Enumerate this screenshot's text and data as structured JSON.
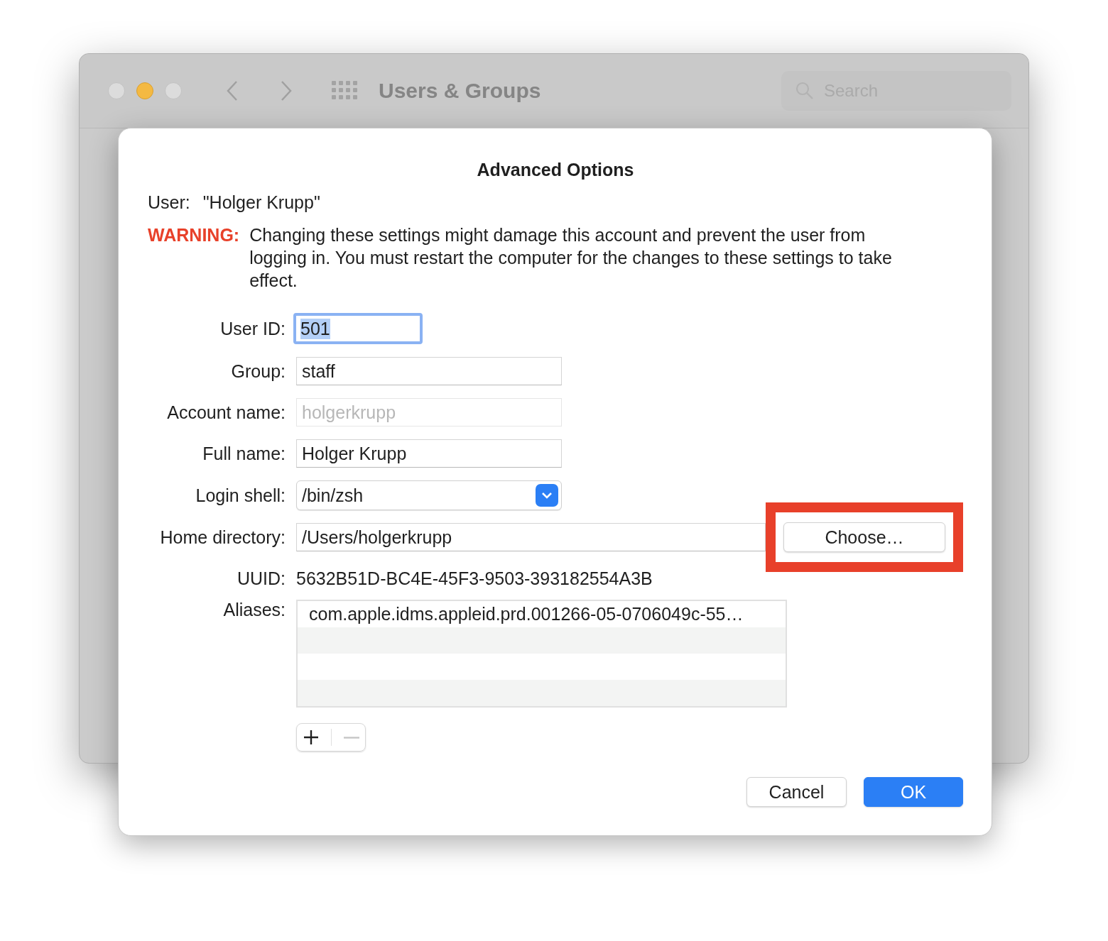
{
  "window": {
    "title": "Users & Groups",
    "search": {
      "placeholder": "Search"
    }
  },
  "sheet": {
    "title": "Advanced Options",
    "user": {
      "label": "User:",
      "value": "\"Holger Krupp\""
    },
    "warning": {
      "label": "WARNING:",
      "text": "Changing these settings might damage this account and prevent the user from logging in. You must restart the computer for the changes to these settings to take effect."
    },
    "fields": [
      {
        "kind": "text",
        "label": "User ID:",
        "value": "501",
        "focused": true,
        "disabled": false
      },
      {
        "kind": "text",
        "label": "Group:",
        "value": "staff",
        "focused": false,
        "disabled": false
      },
      {
        "kind": "text",
        "label": "Account name:",
        "value": "holgerkrupp",
        "focused": false,
        "disabled": true
      },
      {
        "kind": "text",
        "label": "Full name:",
        "value": "Holger Krupp",
        "focused": false,
        "disabled": false
      },
      {
        "kind": "popup",
        "label": "Login shell:",
        "value": "/bin/zsh"
      },
      {
        "kind": "path",
        "label": "Home directory:",
        "value": "/Users/holgerkrupp",
        "button": "Choose…",
        "highlighted": true
      },
      {
        "kind": "static",
        "label": "UUID:",
        "value": "5632B51D-BC4E-45F3-9503-393182554A3B"
      }
    ],
    "aliases": {
      "label": "Aliases:",
      "items": [
        "com.apple.idms.appleid.prd.001266-05-0706049c-55…"
      ],
      "add_disabled": false,
      "remove_disabled": true
    },
    "buttons": [
      {
        "label": "Cancel",
        "default": false
      },
      {
        "label": "OK",
        "default": true
      }
    ]
  }
}
